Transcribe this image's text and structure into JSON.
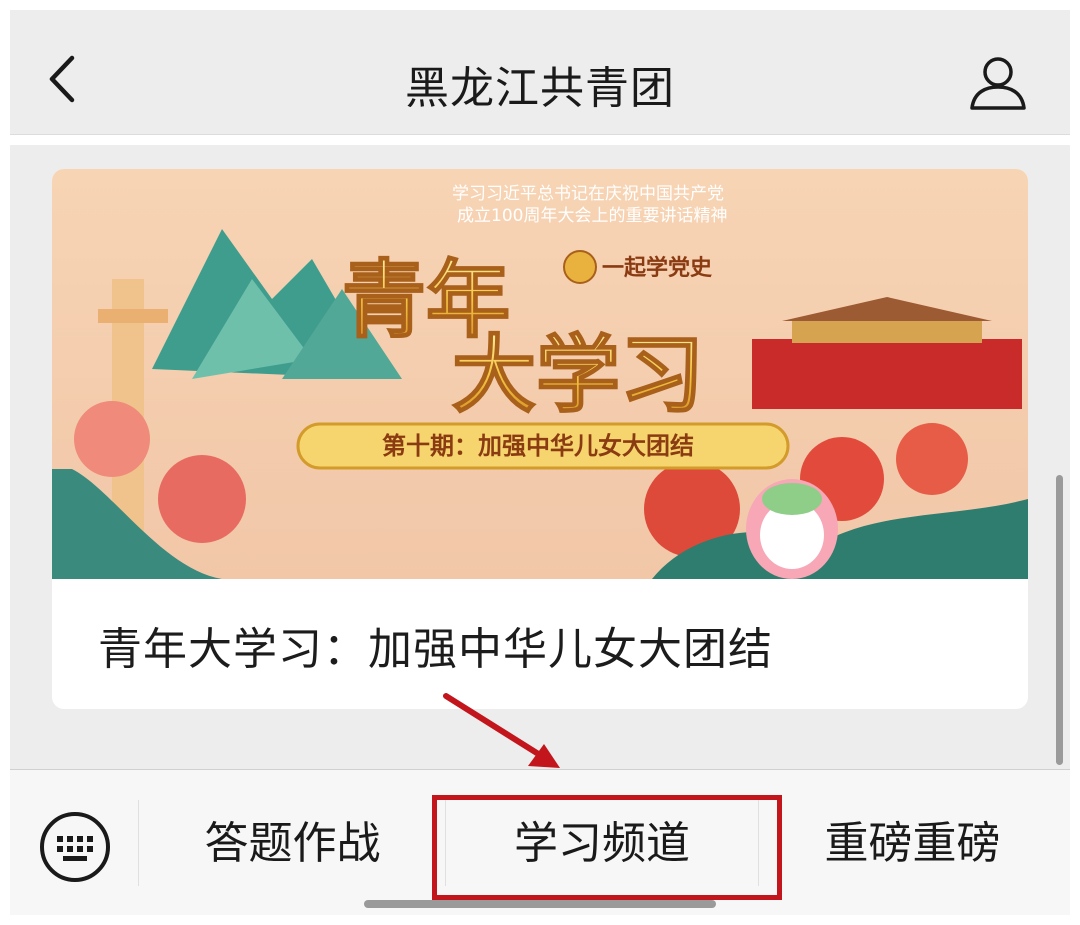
{
  "header": {
    "title": "黑龙江共青团",
    "back_icon": "chevron-left-icon",
    "user_icon": "user-profile-icon"
  },
  "article": {
    "banner": {
      "top_caption_line1": "学习习近平总书记在庆祝中国共产党",
      "top_caption_line2": "成立100周年大会上的重要讲话精神",
      "main_title_line1": "青年",
      "main_title_line2": "大学习",
      "badge_text": "一起学党史",
      "episode_label": "第十期：加强中华儿女大团结"
    },
    "title": "青年大学习：加强中华儿女大团结"
  },
  "bottom_menu": {
    "keyboard_icon": "keyboard-icon",
    "items": [
      {
        "label": "答题作战"
      },
      {
        "label": "学习频道"
      },
      {
        "label": "重磅重磅"
      }
    ]
  },
  "colors": {
    "annotation_red": "#c2161c",
    "banner_peach": "#f4c9a4",
    "banner_gold": "#f2c14a"
  }
}
